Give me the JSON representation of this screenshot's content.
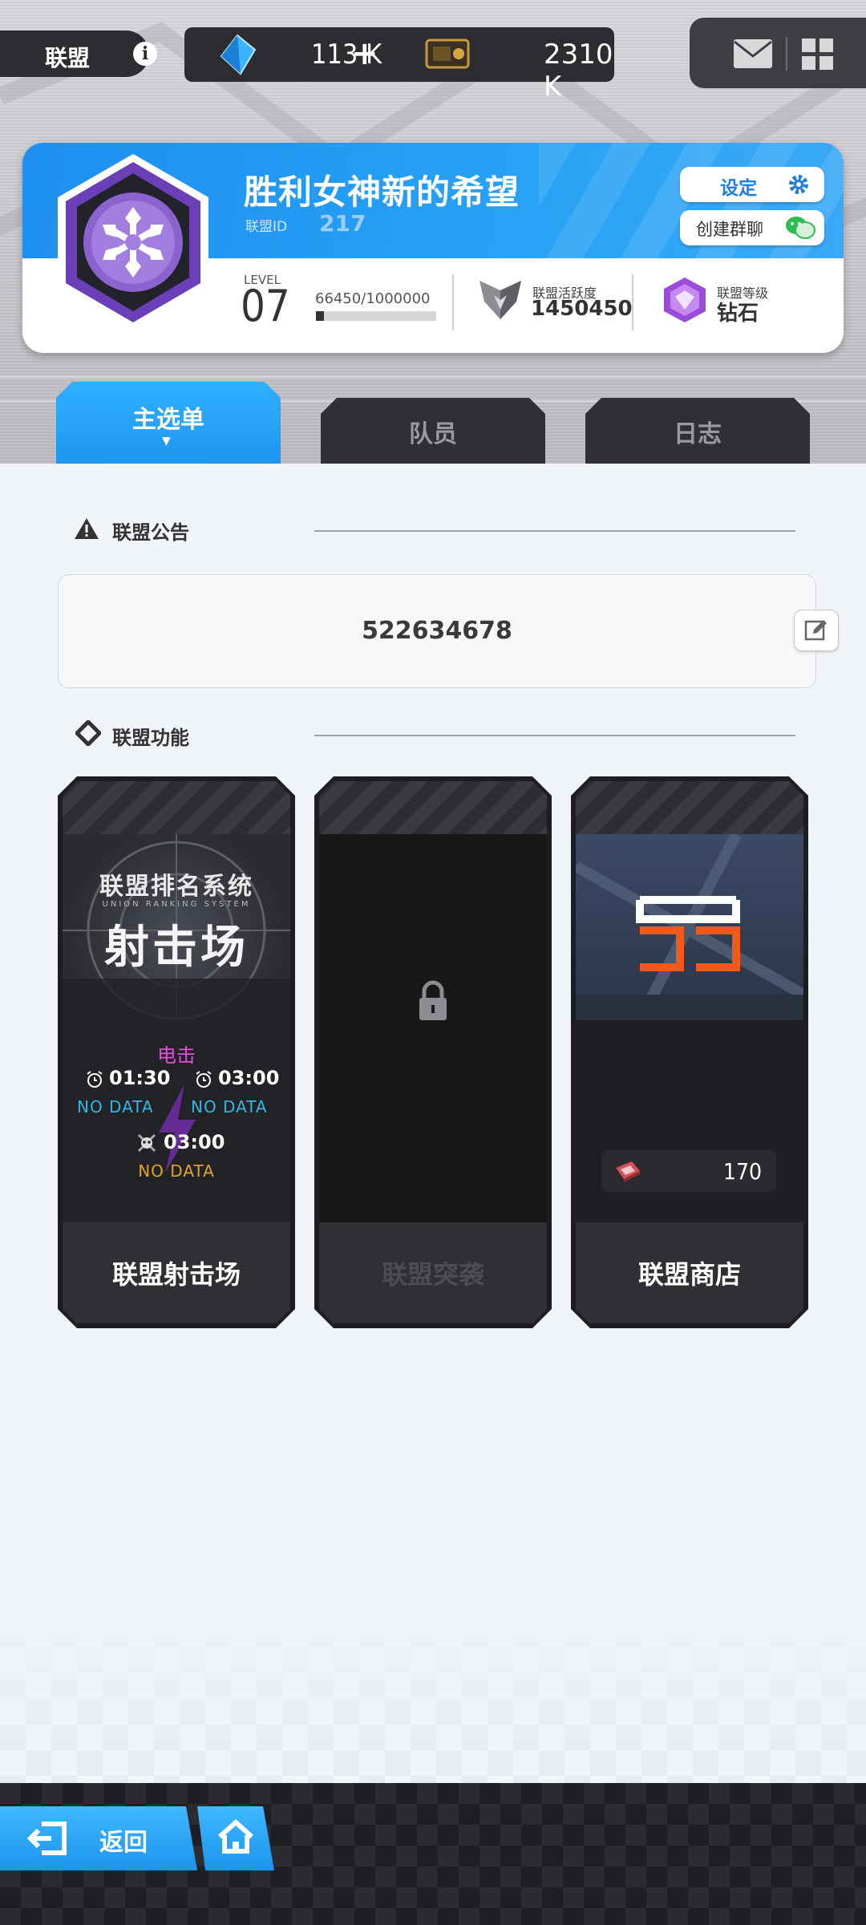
{
  "topbar": {
    "title": "联盟",
    "gems": "113 K",
    "plus": "+",
    "tickets": "2310 K"
  },
  "union": {
    "name": "胜利女神新的希望",
    "id_label": "联盟ID",
    "id_value": "217",
    "settings_label": "设定",
    "group_chat_label": "创建群聊",
    "level_label": "LEVEL",
    "level": "07",
    "exp_text": "66450/1000000",
    "exp_progress": 0.06645,
    "activity_label": "联盟活跃度",
    "activity_value": "1450450",
    "rank_label": "联盟等级",
    "rank_value": "钻石"
  },
  "tabs": [
    {
      "label": "主选单",
      "active": true,
      "indicator": "▼"
    },
    {
      "label": "队员",
      "active": false
    },
    {
      "label": "日志",
      "active": false
    }
  ],
  "notice": {
    "heading": "联盟公告",
    "text": "522634678"
  },
  "functions": {
    "heading": "联盟功能",
    "cards": [
      {
        "label": "联盟射击场",
        "image_title": "联盟排名系统",
        "image_subtitle": "UNION RANKING SYSTEM",
        "image_big": "射击场",
        "mode": "电击",
        "time1": "01:30",
        "time2": "03:00",
        "time3": "03:00",
        "nodata1": "NO DATA",
        "nodata2": "NO DATA",
        "nodata3": "NO DATA"
      },
      {
        "label": "联盟突袭",
        "locked": true
      },
      {
        "label": "联盟商店",
        "count": "170"
      }
    ]
  },
  "bottom": {
    "back_label": "返回"
  },
  "colors": {
    "accent_blue": "#1e95ee",
    "dark_panel": "#2b2d31",
    "mode_pink": "#e24fd8",
    "nodata_blue": "#2fb8e6",
    "nodata_orange": "#e3a32a",
    "shop_orange": "#f05a1a"
  }
}
